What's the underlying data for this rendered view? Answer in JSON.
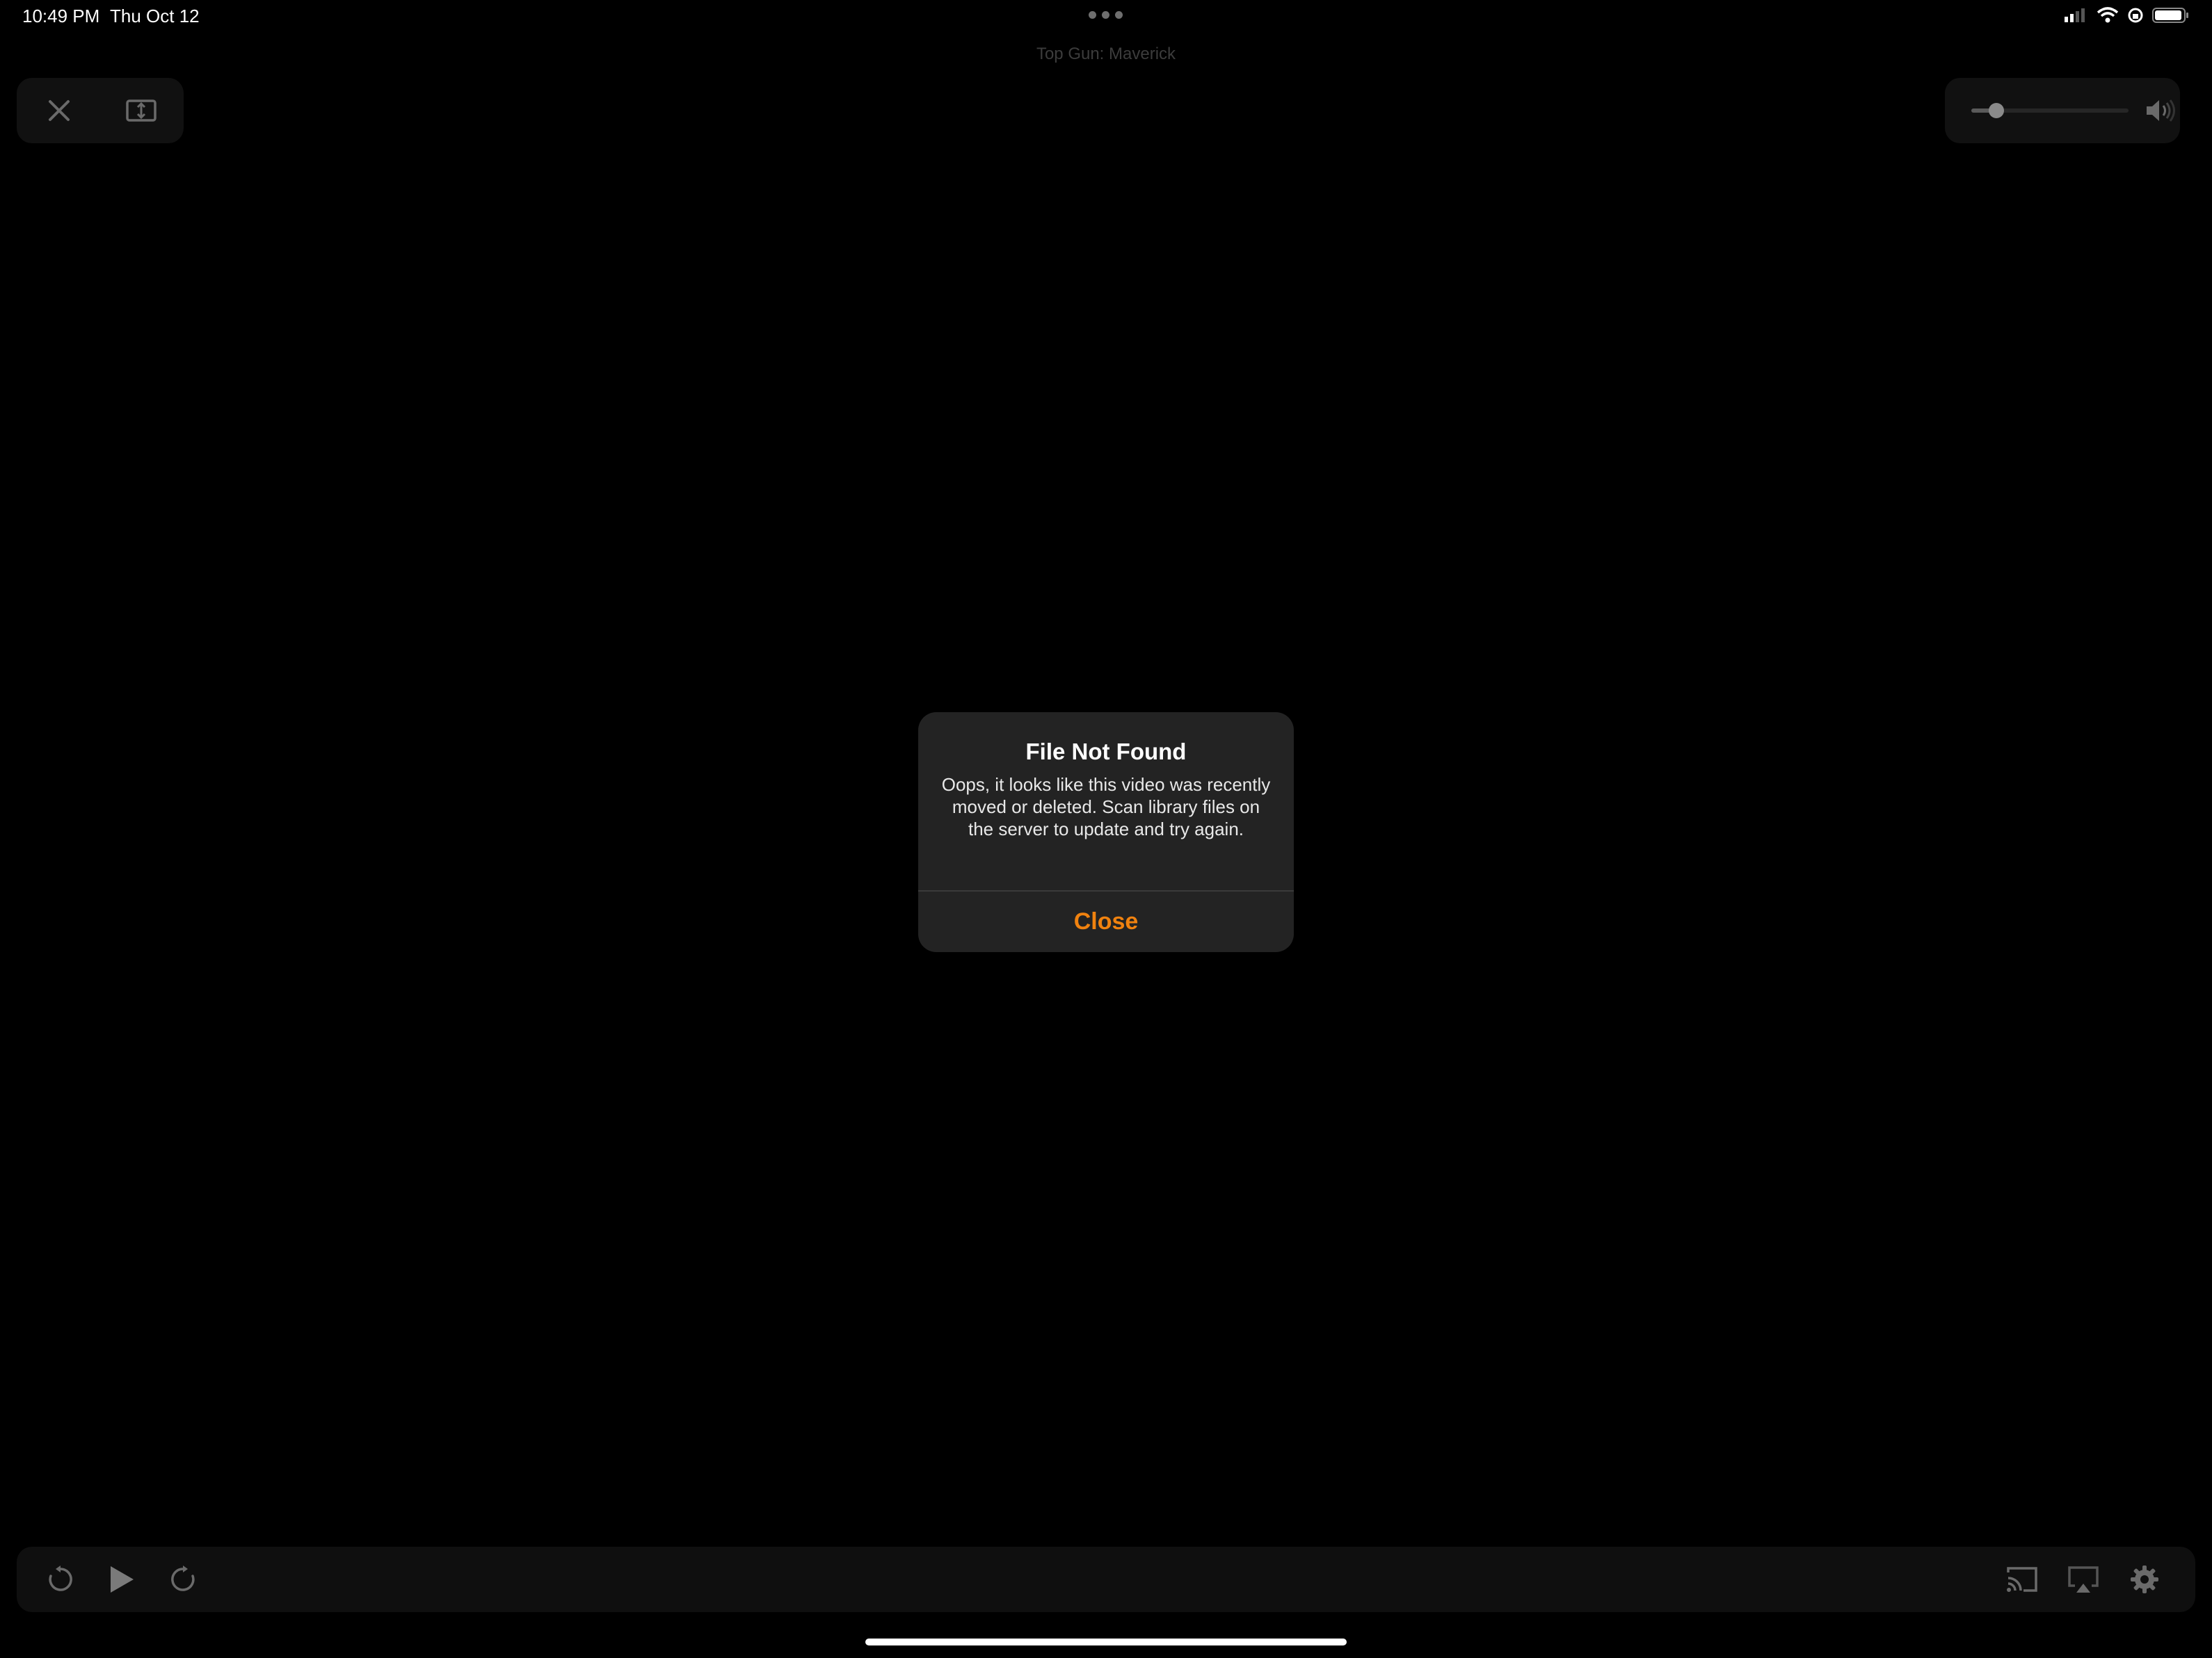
{
  "status_bar": {
    "time": "10:49 PM",
    "date": "Thu Oct 12",
    "icons": [
      "cellular-signal-icon",
      "wifi-icon",
      "orientation-lock-icon",
      "battery-icon"
    ],
    "battery_level": 0.95
  },
  "multitask_icon": "more-dots-icon",
  "player": {
    "title": "Top Gun: Maverick",
    "top_controls": [
      "close-icon",
      "aspect-ratio-icon"
    ],
    "volume_level": 0.16,
    "volume_icon": "speaker-icon",
    "bottom_left_controls": [
      "skip-back-icon",
      "play-icon",
      "skip-forward-icon"
    ],
    "bottom_right_controls": [
      "cast-icon",
      "airplay-icon",
      "gear-icon"
    ]
  },
  "alert": {
    "title": "File Not Found",
    "message": "Oops, it looks like this video was recently moved or deleted. Scan library files on the server to update and try again.",
    "close_label": "Close"
  },
  "colors": {
    "accent": "#f0820f",
    "background": "#000000",
    "alert_background": "#232323"
  }
}
